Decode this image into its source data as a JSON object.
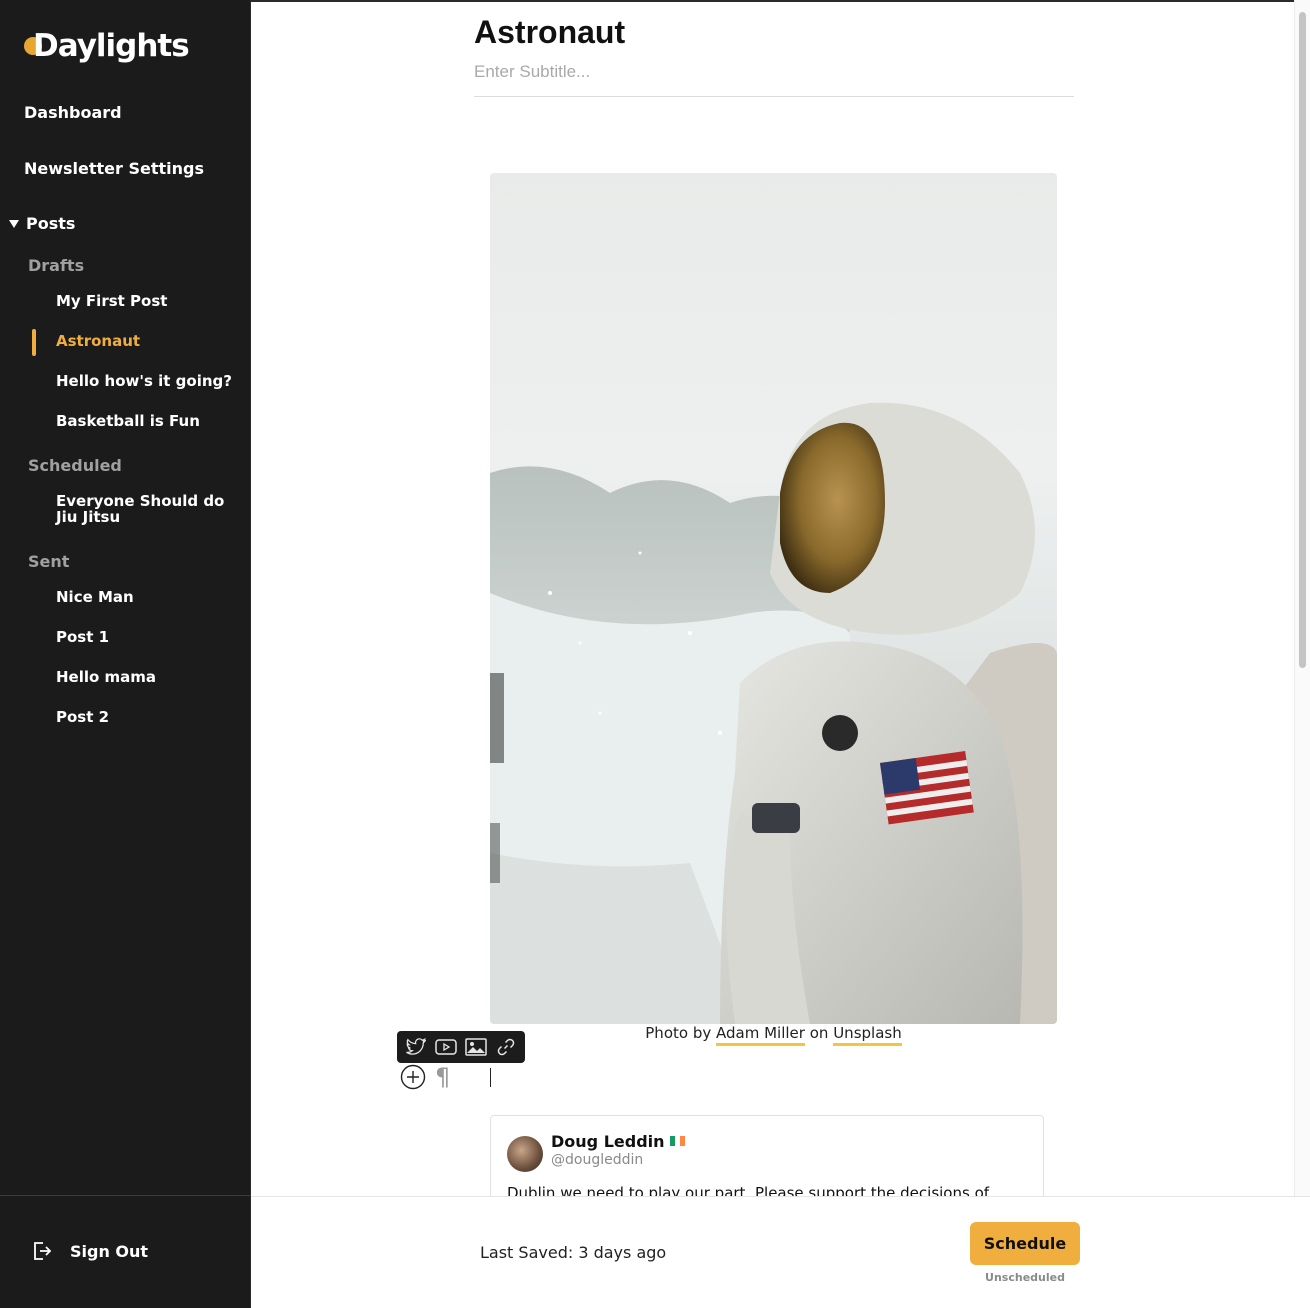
{
  "app": {
    "logo": "Daylights"
  },
  "sidebar": {
    "nav": {
      "dashboard": "Dashboard",
      "newsletter_settings": "Newsletter Settings",
      "posts": "Posts"
    },
    "sections": {
      "drafts": {
        "label": "Drafts",
        "items": [
          "My First Post",
          "Astronaut",
          "Hello how's it going?",
          "Basketball is Fun"
        ],
        "active": "Astronaut"
      },
      "scheduled": {
        "label": "Scheduled",
        "items": [
          "Everyone Should do Jiu Jitsu"
        ]
      },
      "sent": {
        "label": "Sent",
        "items": [
          "Nice Man",
          "Post 1",
          "Hello mama",
          "Post 2"
        ]
      }
    },
    "sign_out": "Sign Out"
  },
  "editor": {
    "title": "Astronaut",
    "subtitle_placeholder": "Enter Subtitle...",
    "image": {
      "caption_prefix": "Photo by",
      "author": "Adam Miller",
      "caption_mid": "on",
      "source": "Unsplash"
    },
    "embed_toolbar": [
      "twitter-icon",
      "youtube-icon",
      "image-icon",
      "link-icon"
    ],
    "insert_buttons": [
      "plus-circle-icon",
      "pilcrow-icon"
    ],
    "pilcrow": "¶",
    "tweet": {
      "name": "Doug Leddin",
      "handle": "@dougleddin",
      "text": "Dublin we need to play our part. Please support the decisions of"
    }
  },
  "footer": {
    "last_saved": "Last Saved: 3 days ago",
    "schedule_button": "Schedule",
    "schedule_status": "Unscheduled"
  },
  "colors": {
    "accent": "#f0ae3e",
    "sidebar_bg": "#1b1b1b",
    "link_underline": "#f0c83e"
  }
}
